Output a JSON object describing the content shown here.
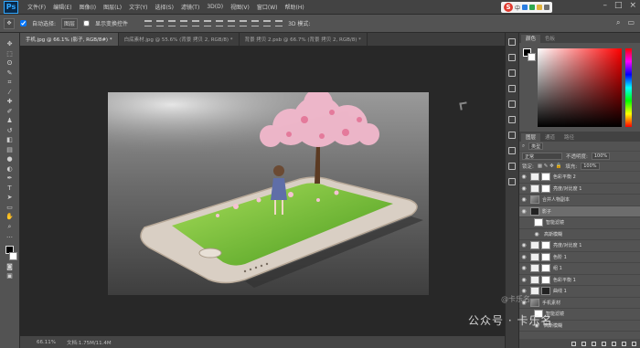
{
  "app": {
    "logo": "Ps"
  },
  "menu": [
    "文件(F)",
    "编辑(E)",
    "图像(I)",
    "图层(L)",
    "文字(Y)",
    "选择(S)",
    "滤镜(T)",
    "3D(D)",
    "视图(V)",
    "窗口(W)",
    "帮助(H)"
  ],
  "tray": {
    "text": "中",
    "icon": "sogou-input-icon"
  },
  "options": {
    "auto_select_label": "自动选择:",
    "auto_select_value": "图层",
    "show_transform_label": "显示变换控件",
    "mode_label": "3D 模式:"
  },
  "tabs": [
    {
      "label": "手机.jpg @ 66.1% (影子, RGB/8#) *"
    },
    {
      "label": "白底素材.jpg @ 55.6% (背景 拷贝 2, RGB/8) *"
    },
    {
      "label": "背景 拷贝 2.psb @ 66.7% (背景 拷贝 2, RGB/8) *"
    }
  ],
  "status": {
    "zoom": "66.11%",
    "doc": "文档:1.75M/11.4M"
  },
  "color_panel": {
    "tabs": [
      "颜色",
      "色板"
    ]
  },
  "layers_panel": {
    "tabs": [
      "图层",
      "通道",
      "路径"
    ],
    "filter_label": "类型",
    "blend_mode": "正常",
    "opacity_label": "不透明度:",
    "opacity_value": "100%",
    "lock_label": "锁定:",
    "fill_label": "填充:",
    "fill_value": "100%",
    "layers": [
      {
        "name": "色彩平衡 2",
        "kind": "adj"
      },
      {
        "name": "亮度/对比度 1",
        "kind": "adj"
      },
      {
        "name": "合并人物副本",
        "kind": "photo"
      },
      {
        "name": "影子",
        "kind": "dark",
        "selected": true
      },
      {
        "name": "智能滤镜",
        "kind": "sub"
      },
      {
        "name": "高斯模糊",
        "kind": "sub"
      },
      {
        "name": "亮度/对比度 1",
        "kind": "adj"
      },
      {
        "name": "色阶 1",
        "kind": "adj"
      },
      {
        "name": "组 1",
        "kind": "group"
      },
      {
        "name": "色彩平衡 1",
        "kind": "adj"
      },
      {
        "name": "曲线 1",
        "kind": "adj"
      },
      {
        "name": "手机素材",
        "kind": "photo"
      },
      {
        "name": "智能滤镜",
        "kind": "sub"
      },
      {
        "name": "高斯模糊",
        "kind": "sub"
      }
    ]
  },
  "watermark": "公众号 · 卡乐名",
  "watermark_small": "@卡乐名",
  "colors": {
    "accent": "#31a8ff",
    "bg_dark": "#282828",
    "panel": "#535353"
  }
}
